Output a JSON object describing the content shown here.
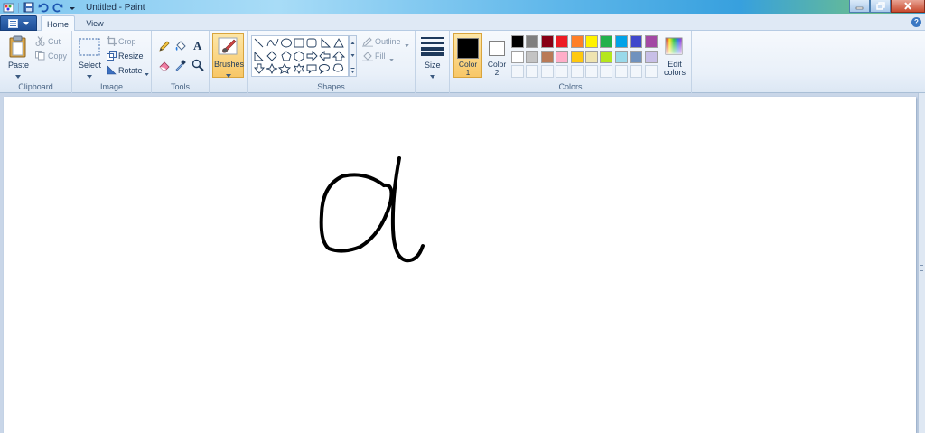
{
  "window": {
    "title": "Untitled - Paint",
    "controls": [
      "minimize",
      "maximize",
      "close"
    ]
  },
  "tabs": [
    {
      "label": "Home",
      "active": true
    },
    {
      "label": "View",
      "active": false
    }
  ],
  "ribbon": {
    "clipboard": {
      "group_label": "Clipboard",
      "paste": "Paste",
      "cut": "Cut",
      "copy": "Copy"
    },
    "image": {
      "group_label": "Image",
      "select": "Select",
      "crop": "Crop",
      "resize": "Resize",
      "rotate": "Rotate"
    },
    "tools": {
      "group_label": "Tools"
    },
    "brushes": {
      "label": "Brushes"
    },
    "shapes": {
      "group_label": "Shapes",
      "outline": "Outline",
      "fill": "Fill"
    },
    "size": {
      "label": "Size"
    },
    "colors": {
      "group_label": "Colors",
      "color1_label": "Color",
      "color1_num": "1",
      "color2_label": "Color",
      "color2_num": "2",
      "edit_label": "Edit",
      "edit_label2": "colors",
      "color1": "#000000",
      "color2": "#ffffff",
      "palette_row1": [
        "#000000",
        "#7f7f7f",
        "#880015",
        "#ed1c24",
        "#ff7f27",
        "#fff200",
        "#22b14c",
        "#00a2e8",
        "#3f48cc",
        "#a349a4"
      ],
      "palette_row2": [
        "#ffffff",
        "#c3c3c3",
        "#b97a57",
        "#ffaec9",
        "#ffc90e",
        "#efe4b0",
        "#b5e61d",
        "#99d9ea",
        "#7092be",
        "#c8bfe7"
      ]
    }
  },
  "canvas": {
    "background": "#ffffff",
    "stroke_color": "#000000"
  }
}
